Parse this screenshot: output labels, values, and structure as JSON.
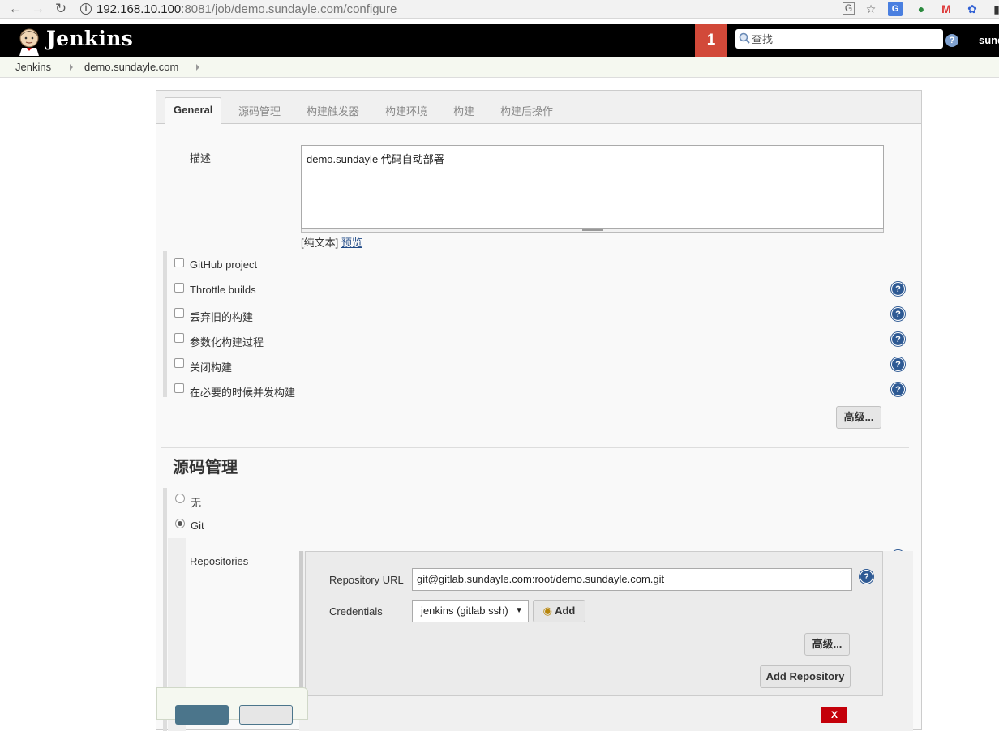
{
  "browser": {
    "url_host": "192.168.10.100",
    "url_rest": ":8081/job/demo.sundayle.com/configure"
  },
  "header": {
    "app_title": "Jenkins",
    "notification_count": "1",
    "search_placeholder": "查找",
    "user_name": "sundayle"
  },
  "breadcrumbs": [
    "Jenkins",
    "demo.sundayle.com"
  ],
  "tabs": [
    "General",
    "源码管理",
    "构建触发器",
    "构建环境",
    "构建",
    "构建后操作"
  ],
  "general": {
    "description_label": "描述",
    "description_value": "demo.sundayle 代码自动部署",
    "format_prefix": "[纯文本]",
    "preview_link": "预览",
    "options": [
      {
        "label": "GitHub project",
        "checked": false
      },
      {
        "label": "Throttle builds",
        "checked": false
      },
      {
        "label": "丢弃旧的构建",
        "checked": false
      },
      {
        "label": "参数化构建过程",
        "checked": false
      },
      {
        "label": "关闭构建",
        "checked": false
      },
      {
        "label": "在必要的时候并发构建",
        "checked": false
      }
    ],
    "advanced_label": "高级..."
  },
  "scm": {
    "title": "源码管理",
    "options": [
      {
        "label": "无",
        "selected": false
      },
      {
        "label": "Git",
        "selected": true
      }
    ],
    "repositories_label": "Repositories",
    "repo_url_label": "Repository URL",
    "repo_url_value": "git@gitlab.sundayle.com:root/demo.sundayle.com.git",
    "credentials_label": "Credentials",
    "credentials_value": "jenkins (gitlab ssh)",
    "add_label": "Add",
    "advanced_label": "高级...",
    "add_repository_label": "Add Repository",
    "delete_label": "X"
  },
  "colors": {
    "header_bg": "#000000",
    "notification_bg": "#d24939",
    "help_icon": "#2e5a94",
    "save_button": "#4b758b",
    "delete_button": "#c4000a"
  },
  "icons": [
    "back-icon",
    "forward-icon",
    "reload-icon",
    "info-icon",
    "translate-icon",
    "star-icon",
    "jenkins-butler-logo",
    "search-icon",
    "help-icon",
    "key-icon",
    "chevron-down-icon"
  ]
}
